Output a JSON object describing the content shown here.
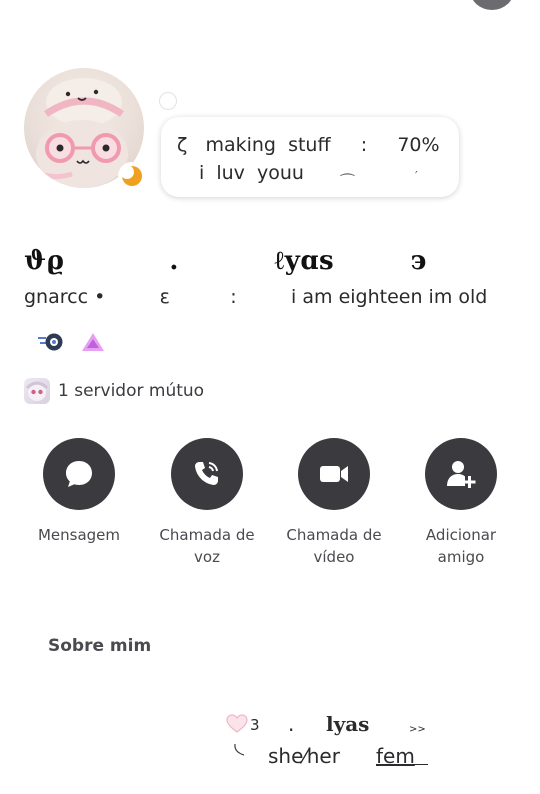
{
  "status": {
    "line1": "ζ   making  stuff     :     70%",
    "line2": "i  luv  youu",
    "tilde": "⁀",
    "tick": "′"
  },
  "profile": {
    "display_name": "ϑϱ           .          ℓyɑs        ϶",
    "username_line": "gnarcc •         ε          :         i am eighteen im old",
    "mutual_servers": "1 servidor mútuo"
  },
  "actions": [
    {
      "label": "Mensagem",
      "icon": "message-bubble-icon"
    },
    {
      "label": "Chamada de\nvoz",
      "icon": "phone-call-icon"
    },
    {
      "label": "Chamada de\nvídeo",
      "icon": "video-camera-icon"
    },
    {
      "label": "Adicionar\namigo",
      "icon": "add-friend-icon"
    }
  ],
  "about": {
    "title": "Sobre mim",
    "bio_heart_count": "3",
    "bio_dot": ".",
    "bio_name": "lyas",
    "bio_arrows": ">>",
    "bio_pronouns": "she⁄her",
    "bio_fem": "fem"
  },
  "colors": {
    "action_circle": "#3a3a3f",
    "status_moon": "#f0a020",
    "badge_purple": "#c060e0",
    "badge_blue": "#5a7ac8"
  }
}
